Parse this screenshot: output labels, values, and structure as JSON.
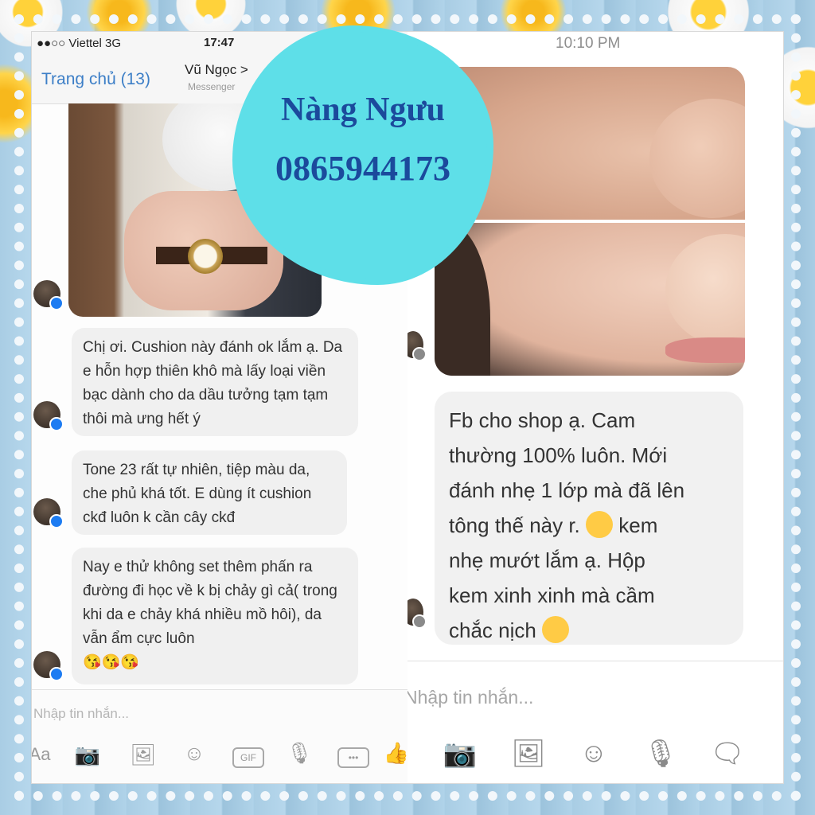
{
  "left_chat": {
    "status_bar": {
      "carrier": "●●○○ Viettel  3G",
      "time": "17:47"
    },
    "nav": {
      "back_label": "Trang chủ (13)",
      "contact_name": "Vũ Ngọc >",
      "contact_sub": "Messenger"
    },
    "messages": [
      {
        "text": "Chị ơi. Cushion này đánh ok lắm ạ. Da e hỗn hợp thiên khô mà lấy loại viền bạc dành cho da dầu tưởng tạm tạm thôi mà ưng hết ý"
      },
      {
        "text": "Tone 23 rất tự nhiên, tiệp màu da, che phủ khá tốt. E dùng ít cushion ckđ luôn k cần cây ckđ"
      },
      {
        "text": "Nay e thử không set thêm phấn ra đường đi học về k bị chảy gì cả( trong khi da e chảy khá nhiều mồ hôi), da vẫn ẩm cực luôn"
      }
    ],
    "message_emojis": "😘😘😘",
    "composer_placeholder": "Nhập tin nhắn...",
    "toolbar": {
      "aa": "Aa",
      "gif": "GIF",
      "more": "•••"
    }
  },
  "right_chat": {
    "time": "10:10 PM",
    "message_lines": [
      "Fb cho shop ạ. Cam",
      "thường 100% luôn. Mới",
      "đánh nhẹ 1 lớp mà đã lên",
      "tông thế này r.",
      "kem",
      "nhẹ mướt lắm ạ. Hộp",
      "kem xinh xinh mà cầm",
      "chắc nịch"
    ],
    "composer_placeholder": "Nhập tin nhắn..."
  },
  "sticker": {
    "name": "Nàng Ngưu",
    "phone": "0865944173"
  },
  "colors": {
    "accent_blue": "#3d7fc7",
    "sticker_bg": "#5edfe8",
    "sticker_text": "#1b4a9c",
    "messenger_blue": "#1d7cf2"
  },
  "icons": [
    "camera-icon",
    "image-icon",
    "smile-icon",
    "gif-icon",
    "microphone-icon",
    "more-icon",
    "thumbs-up-icon",
    "sticker-icon"
  ]
}
